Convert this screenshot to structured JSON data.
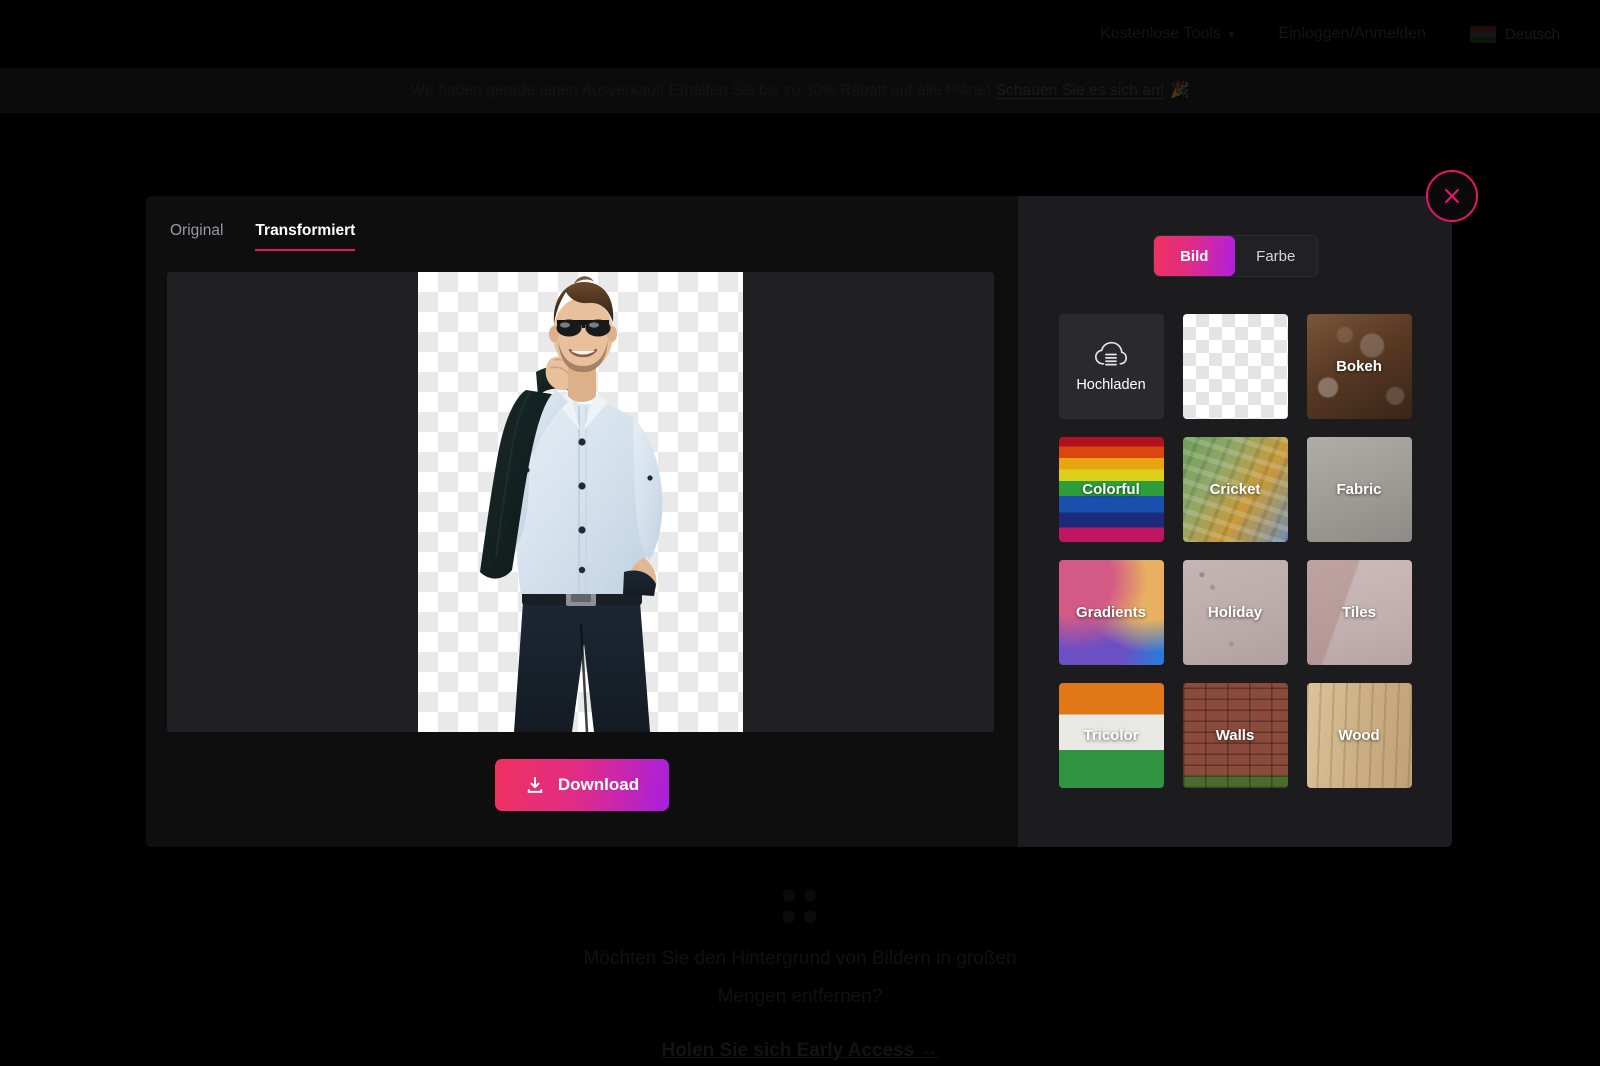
{
  "header": {
    "nav_item": "Kostenlose Tools",
    "nav_chevron": "chevron-down-icon",
    "login_label": "Einloggen/Anmelden",
    "language_label": "Deutsch",
    "flag_icon": "flag-icon"
  },
  "promo_bar": {
    "text": "Wir haben gerade einen Ausverkauf! Erhalten Sie bis zu 30% Rabatt auf alle Pläne!",
    "link_text": "Schauen Sie es sich an!",
    "emoji": "🎉"
  },
  "modal": {
    "tabs": [
      {
        "label": "Original",
        "active": false
      },
      {
        "label": "Transformiert",
        "active": true
      }
    ],
    "download_label": "Download",
    "download_icon": "download-icon",
    "close_icon": "close-icon",
    "preview": {
      "alt": "Mann im hellblauen Hemd mit Sonnenbrille und Jackett über der Schulter, Hintergrund entfernt",
      "background": "transparent-checkerboard"
    },
    "background_panel": {
      "segmented": [
        {
          "label": "Bild",
          "active": true
        },
        {
          "label": "Farbe",
          "active": false
        }
      ],
      "thumbnails": [
        {
          "label": "Hochladen",
          "kind": "upload",
          "icon": "cloud-upload-icon"
        },
        {
          "label": "",
          "kind": "none"
        },
        {
          "label": "Bokeh",
          "kind": "bokeh"
        },
        {
          "label": "Colorful",
          "kind": "colorful"
        },
        {
          "label": "Cricket",
          "kind": "cricket"
        },
        {
          "label": "Fabric",
          "kind": "fabric"
        },
        {
          "label": "Gradients",
          "kind": "gradients"
        },
        {
          "label": "Holiday",
          "kind": "holiday"
        },
        {
          "label": "Tiles",
          "kind": "tiles"
        },
        {
          "label": "Tricolor",
          "kind": "tricolor"
        },
        {
          "label": "Walls",
          "kind": "walls"
        },
        {
          "label": "Wood",
          "kind": "wood"
        }
      ]
    }
  },
  "footer_promo": {
    "line1": "Möchten Sie den Hintergrund von Bildern in großen",
    "line2": "Mengen entfernen?",
    "cta": "Holen Sie sich Early Access →",
    "logo_icon": "app-logo-icon"
  },
  "colors": {
    "accent_pink": "#e8156b",
    "gradient_start": "#f0315f",
    "gradient_mid": "#e02c86",
    "gradient_end": "#a81fe0",
    "modal_left_bg": "#0e0e0f",
    "modal_right_bg": "#1c1c1e",
    "preview_bg": "#202022"
  }
}
